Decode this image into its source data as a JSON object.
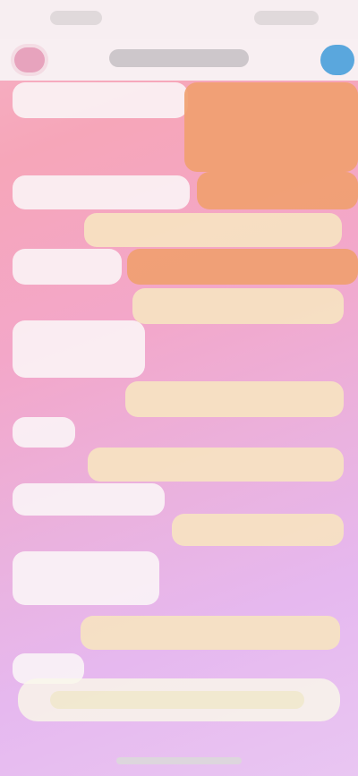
{
  "status_bar": {
    "time": "",
    "indicators": ""
  },
  "header": {
    "title": "",
    "left_avatar_icon": "avatar-icon",
    "right_avatar_icon": "avatar-icon"
  },
  "messages": [
    {
      "side": "left",
      "style": "incoming",
      "text": ""
    },
    {
      "side": "right",
      "style": "outgoing-orange",
      "text": ""
    },
    {
      "side": "left",
      "style": "incoming",
      "text": ""
    },
    {
      "side": "right",
      "style": "outgoing-orange",
      "text": ""
    },
    {
      "side": "right",
      "style": "outgoing-yellow",
      "text": ""
    },
    {
      "side": "left",
      "style": "incoming",
      "text": ""
    },
    {
      "side": "right",
      "style": "outgoing-orange",
      "text": ""
    },
    {
      "side": "left",
      "style": "incoming",
      "text": ""
    },
    {
      "side": "right",
      "style": "outgoing-yellow",
      "text": ""
    },
    {
      "side": "left",
      "style": "incoming",
      "text": ""
    },
    {
      "side": "right",
      "style": "outgoing-yellow",
      "text": ""
    },
    {
      "side": "left",
      "style": "incoming",
      "text": ""
    },
    {
      "side": "right",
      "style": "outgoing-yellow",
      "text": ""
    },
    {
      "side": "left",
      "style": "incoming",
      "text": ""
    },
    {
      "side": "right",
      "style": "outgoing-yellow",
      "text": ""
    },
    {
      "side": "left",
      "style": "incoming",
      "text": ""
    }
  ],
  "composer": {
    "placeholder": ""
  },
  "colors": {
    "incoming_bubble": "#faf6f7",
    "outgoing_orange": "#f09f70",
    "outgoing_yellow": "#f6e3c1",
    "accent_blue": "#5aa7dd",
    "accent_pink": "#e7a3bd"
  }
}
